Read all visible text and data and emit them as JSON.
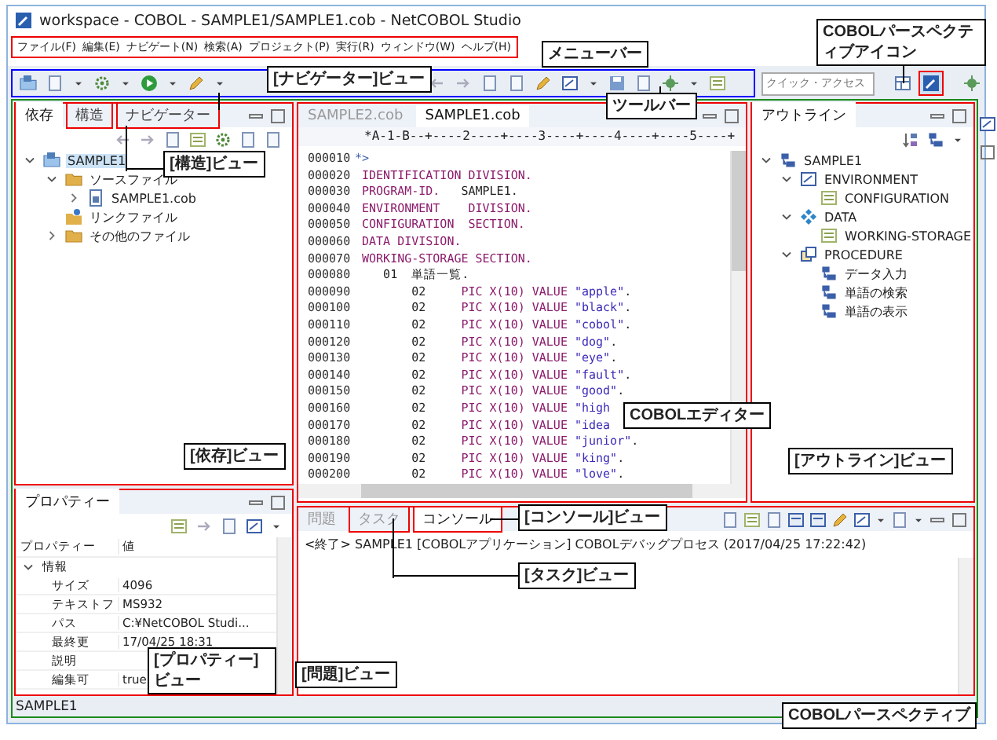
{
  "window": {
    "title": "workspace - COBOL - SAMPLE1/SAMPLE1.cob - NetCOBOL Studio"
  },
  "menu": [
    "ファイル(F)",
    "編集(E)",
    "ナビゲート(N)",
    "検索(A)",
    "プロジェクト(P)",
    "実行(R)",
    "ウィンドウ(W)",
    "ヘルプ(H)"
  ],
  "toolbar": {
    "quick_access": {
      "placeholder": "クイック・アクセス"
    }
  },
  "left_view": {
    "tabs": [
      {
        "label": "依存",
        "selected": true,
        "framed": false
      },
      {
        "label": "構造",
        "selected": false,
        "framed": true
      },
      {
        "label": "ナビゲーター",
        "selected": false,
        "framed": true
      }
    ],
    "tree": [
      {
        "label": "SAMPLE1",
        "kind": "project",
        "expanded": true,
        "selected": true,
        "children": [
          {
            "label": "ソースファイル",
            "kind": "folder",
            "expanded": true,
            "selected": false,
            "children": [
              {
                "label": "SAMPLE1.cob",
                "kind": "file",
                "expanded": false,
                "selected": false
              }
            ]
          },
          {
            "label": "リンクファイル",
            "kind": "link",
            "selected": false
          },
          {
            "label": "その他のファイル",
            "kind": "folder",
            "expanded": false,
            "selected": false
          }
        ]
      }
    ]
  },
  "properties": {
    "title": "プロパティー",
    "columns": [
      "プロパティー",
      "値"
    ],
    "group": {
      "label": "情報",
      "expanded": true
    },
    "rows": [
      {
        "name": "サイズ",
        "value": "4096"
      },
      {
        "name": "テキストフ",
        "value": "MS932"
      },
      {
        "name": "パス",
        "value": "C:¥NetCOBOL Studi..."
      },
      {
        "name": "最終更",
        "value": "17/04/25 18:31"
      },
      {
        "name": "説明"
      },
      {
        "name": "編集可",
        "value": "true"
      }
    ]
  },
  "editor": {
    "tabs": [
      {
        "label": "SAMPLE2.cob",
        "selected": false
      },
      {
        "label": "SAMPLE1.cob",
        "selected": true
      }
    ],
    "ruler": "*A-1-B--+----2----+----3----+----4----+----5----+",
    "lines": [
      {
        "no": "000010",
        "parts": [
          {
            "kind": "comment",
            "text": "*>"
          }
        ]
      },
      {
        "no": "000020",
        "parts": [
          {
            "kind": "keyword",
            "text": " IDENTIFICATION DIVISION."
          }
        ]
      },
      {
        "no": "000030",
        "parts": [
          {
            "kind": "keyword",
            "text": " PROGRAM-ID."
          },
          {
            "kind": "plain",
            "text": "   SAMPLE1."
          }
        ]
      },
      {
        "no": "000040",
        "parts": [
          {
            "kind": "keyword",
            "text": " ENVIRONMENT    DIVISION."
          }
        ]
      },
      {
        "no": "000050",
        "parts": [
          {
            "kind": "keyword",
            "text": " CONFIGURATION  SECTION."
          }
        ]
      },
      {
        "no": "000060",
        "parts": [
          {
            "kind": "keyword",
            "text": " DATA DIVISION."
          }
        ]
      },
      {
        "no": "000070",
        "parts": [
          {
            "kind": "keyword",
            "text": " WORKING-STORAGE SECTION."
          }
        ]
      },
      {
        "no": "000080",
        "parts": [
          {
            "kind": "plain",
            "text": "    01  単語一覧."
          }
        ]
      },
      {
        "no": "000090",
        "parts": [
          {
            "kind": "plain",
            "text": "        02     "
          },
          {
            "kind": "keyword",
            "text": "PIC X(10) VALUE "
          },
          {
            "kind": "string",
            "text": "\"apple\""
          },
          {
            "kind": "plain",
            "text": "."
          }
        ]
      },
      {
        "no": "000100",
        "parts": [
          {
            "kind": "plain",
            "text": "        02     "
          },
          {
            "kind": "keyword",
            "text": "PIC X(10) VALUE "
          },
          {
            "kind": "string",
            "text": "\"black\""
          },
          {
            "kind": "plain",
            "text": "."
          }
        ]
      },
      {
        "no": "000110",
        "parts": [
          {
            "kind": "plain",
            "text": "        02     "
          },
          {
            "kind": "keyword",
            "text": "PIC X(10) VALUE "
          },
          {
            "kind": "string",
            "text": "\"cobol\""
          },
          {
            "kind": "plain",
            "text": "."
          }
        ]
      },
      {
        "no": "000120",
        "parts": [
          {
            "kind": "plain",
            "text": "        02     "
          },
          {
            "kind": "keyword",
            "text": "PIC X(10) VALUE "
          },
          {
            "kind": "string",
            "text": "\"dog\""
          },
          {
            "kind": "plain",
            "text": "."
          }
        ]
      },
      {
        "no": "000130",
        "parts": [
          {
            "kind": "plain",
            "text": "        02     "
          },
          {
            "kind": "keyword",
            "text": "PIC X(10) VALUE "
          },
          {
            "kind": "string",
            "text": "\"eye\""
          },
          {
            "kind": "plain",
            "text": "."
          }
        ]
      },
      {
        "no": "000140",
        "parts": [
          {
            "kind": "plain",
            "text": "        02     "
          },
          {
            "kind": "keyword",
            "text": "PIC X(10) VALUE "
          },
          {
            "kind": "string",
            "text": "\"fault\""
          },
          {
            "kind": "plain",
            "text": "."
          }
        ]
      },
      {
        "no": "000150",
        "parts": [
          {
            "kind": "plain",
            "text": "        02     "
          },
          {
            "kind": "keyword",
            "text": "PIC X(10) VALUE "
          },
          {
            "kind": "string",
            "text": "\"good\""
          },
          {
            "kind": "plain",
            "text": "."
          }
        ]
      },
      {
        "no": "000160",
        "parts": [
          {
            "kind": "plain",
            "text": "        02     "
          },
          {
            "kind": "keyword",
            "text": "PIC X(10) VALUE "
          },
          {
            "kind": "string",
            "text": "\"high"
          }
        ]
      },
      {
        "no": "000170",
        "parts": [
          {
            "kind": "plain",
            "text": "        02     "
          },
          {
            "kind": "keyword",
            "text": "PIC X(10) VALUE "
          },
          {
            "kind": "string",
            "text": "\"idea"
          }
        ]
      },
      {
        "no": "000180",
        "parts": [
          {
            "kind": "plain",
            "text": "        02     "
          },
          {
            "kind": "keyword",
            "text": "PIC X(10) VALUE "
          },
          {
            "kind": "string",
            "text": "\"junior\""
          },
          {
            "kind": "plain",
            "text": "."
          }
        ]
      },
      {
        "no": "000190",
        "parts": [
          {
            "kind": "plain",
            "text": "        02     "
          },
          {
            "kind": "keyword",
            "text": "PIC X(10) VALUE "
          },
          {
            "kind": "string",
            "text": "\"king\""
          },
          {
            "kind": "plain",
            "text": "."
          }
        ]
      },
      {
        "no": "000200",
        "parts": [
          {
            "kind": "plain",
            "text": "        02     "
          },
          {
            "kind": "keyword",
            "text": "PIC X(10) VALUE "
          },
          {
            "kind": "string",
            "text": "\"love\""
          },
          {
            "kind": "plain",
            "text": "."
          }
        ]
      }
    ]
  },
  "outline": {
    "title": "アウトライン",
    "tree": [
      {
        "label": "SAMPLE1",
        "kind": "program",
        "expanded": true,
        "children": [
          {
            "label": "ENVIRONMENT",
            "kind": "division",
            "expanded": true,
            "children": [
              {
                "label": "CONFIGURATION",
                "kind": "section"
              }
            ]
          },
          {
            "label": "DATA",
            "kind": "data",
            "expanded": true,
            "children": [
              {
                "label": "WORKING-STORAGE",
                "kind": "section"
              }
            ]
          },
          {
            "label": "PROCEDURE",
            "kind": "procedure",
            "expanded": true,
            "children": [
              {
                "label": "データ入力",
                "kind": "paragraph"
              },
              {
                "label": "単語の検索",
                "kind": "paragraph"
              },
              {
                "label": "単語の表示",
                "kind": "paragraph"
              }
            ]
          }
        ]
      }
    ]
  },
  "console": {
    "tabs": [
      {
        "label": "問題",
        "selected": false,
        "framed": false
      },
      {
        "label": "タスク",
        "selected": false,
        "framed": true
      },
      {
        "label": "コンソール",
        "selected": true,
        "framed": true
      }
    ],
    "text": "<終了> SAMPLE1 [COBOLアプリケーション] COBOLデバッグプロセス (2017/04/25 17:22:42)"
  },
  "status_bar": {
    "text": "SAMPLE1"
  },
  "callouts": [
    "メニューバー",
    "COBOLパースペクティブアイコン",
    "[ナビゲーター]ビュー",
    "ツールバー",
    "[構造]ビュー",
    "COBOLエディター",
    "[依存]ビュー",
    "[アウトライン]ビュー",
    "[コンソール]ビュー",
    "[タスク]ビュー",
    "[プロパティー]ビュー",
    "[問題]ビュー",
    "COBOLパースペクティブ"
  ]
}
